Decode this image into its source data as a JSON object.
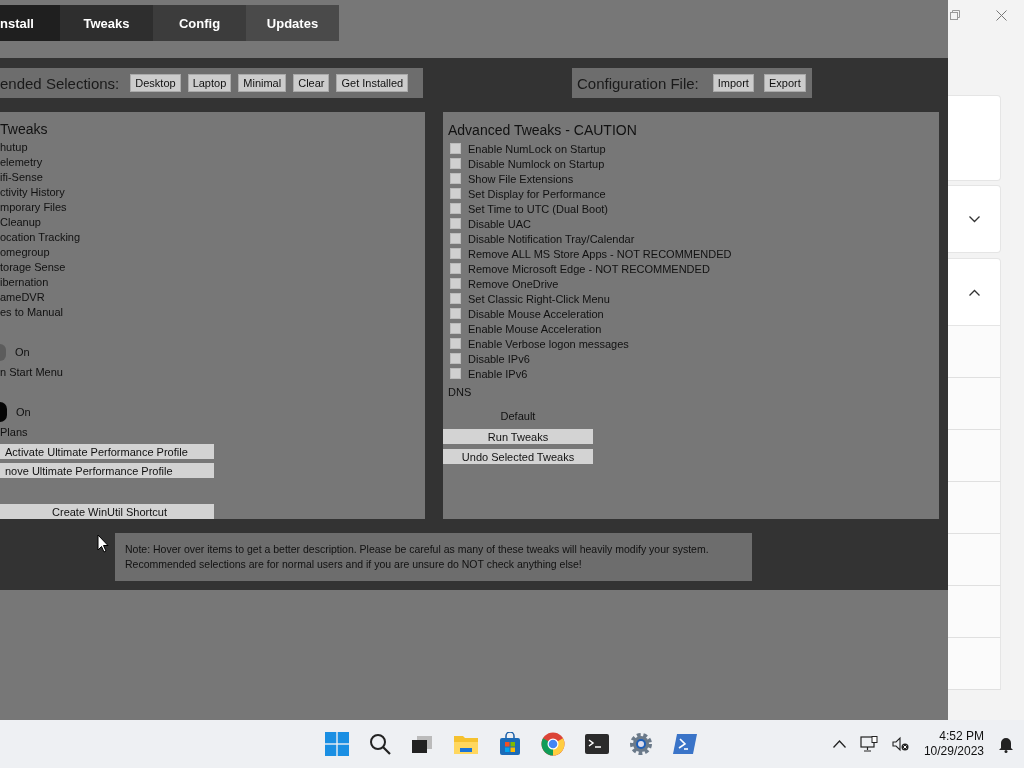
{
  "tabs": [
    {
      "label": "nstall",
      "selected": true
    },
    {
      "label": "Tweaks",
      "selected": false
    },
    {
      "label": "Config",
      "selected": false
    },
    {
      "label": "Updates",
      "selected": false
    }
  ],
  "selections": {
    "label": "ended Selections:",
    "buttons": [
      "Desktop",
      "Laptop",
      "Minimal",
      "Clear",
      "Get Installed"
    ]
  },
  "config_file": {
    "label": "Configuration File:",
    "buttons": [
      "Import",
      "Export"
    ]
  },
  "left_panel": {
    "heading": "Tweaks",
    "items": [
      {
        "kind": "text",
        "label": "hutup"
      },
      {
        "kind": "text",
        "label": "elemetry"
      },
      {
        "kind": "text",
        "label": "ifi-Sense"
      },
      {
        "kind": "text",
        "label": "ctivity History"
      },
      {
        "kind": "text",
        "label": "mporary Files"
      },
      {
        "kind": "text",
        "label": "Cleanup"
      },
      {
        "kind": "text",
        "label": "ocation Tracking"
      },
      {
        "kind": "text",
        "label": "omegroup"
      },
      {
        "kind": "text",
        "label": "torage Sense"
      },
      {
        "kind": "text",
        "label": "ibernation"
      },
      {
        "kind": "text",
        "label": "ameDVR"
      },
      {
        "kind": "text",
        "label": "es to Manual"
      },
      {
        "kind": "toggle",
        "label": "On",
        "on": false
      },
      {
        "kind": "text",
        "label": "n Start Menu"
      },
      {
        "kind": "toggle",
        "label": "On",
        "on": true
      },
      {
        "kind": "text",
        "label": "Plans"
      },
      {
        "kind": "button",
        "label": "Activate Ultimate Performance Profile"
      },
      {
        "kind": "button",
        "label": "nove Ultimate Performance Profile"
      },
      {
        "kind": "button",
        "label": "Create WinUtil Shortcut"
      }
    ]
  },
  "advanced": {
    "heading": "Advanced Tweaks - CAUTION",
    "options": [
      {
        "label": "Enable NumLock on Startup",
        "checked": false
      },
      {
        "label": "Disable Numlock on Startup",
        "checked": false
      },
      {
        "label": "Show File Extensions",
        "checked": false
      },
      {
        "label": "Set Display for Performance",
        "checked": false
      },
      {
        "label": "Set Time to UTC (Dual Boot)",
        "checked": false
      },
      {
        "label": "Disable UAC",
        "checked": false
      },
      {
        "label": "Disable Notification Tray/Calendar",
        "checked": false
      },
      {
        "label": "Remove ALL MS Store Apps - NOT RECOMMENDED",
        "checked": false
      },
      {
        "label": "Remove Microsoft Edge - NOT RECOMMENDED",
        "checked": false
      },
      {
        "label": "Remove OneDrive",
        "checked": false
      },
      {
        "label": "Set Classic Right-Click Menu",
        "checked": false
      },
      {
        "label": "Disable Mouse Acceleration",
        "checked": false
      },
      {
        "label": "Enable Mouse Acceleration",
        "checked": false
      },
      {
        "label": "Enable Verbose logon messages",
        "checked": false
      },
      {
        "label": "Disable IPv6",
        "checked": false
      },
      {
        "label": "Enable IPv6",
        "checked": false
      }
    ],
    "dns_label": "DNS",
    "dns_value": "Default",
    "buttons": [
      "Run Tweaks",
      "Undo Selected Tweaks"
    ]
  },
  "note": "Note: Hover over items to get a better description. Please be careful as many of these tweaks will heavily modify your system.\nRecommended selections are for normal users and if you are unsure do NOT check anything else!",
  "taskbar": {
    "time": "4:52 PM",
    "date": "10/29/2023"
  }
}
